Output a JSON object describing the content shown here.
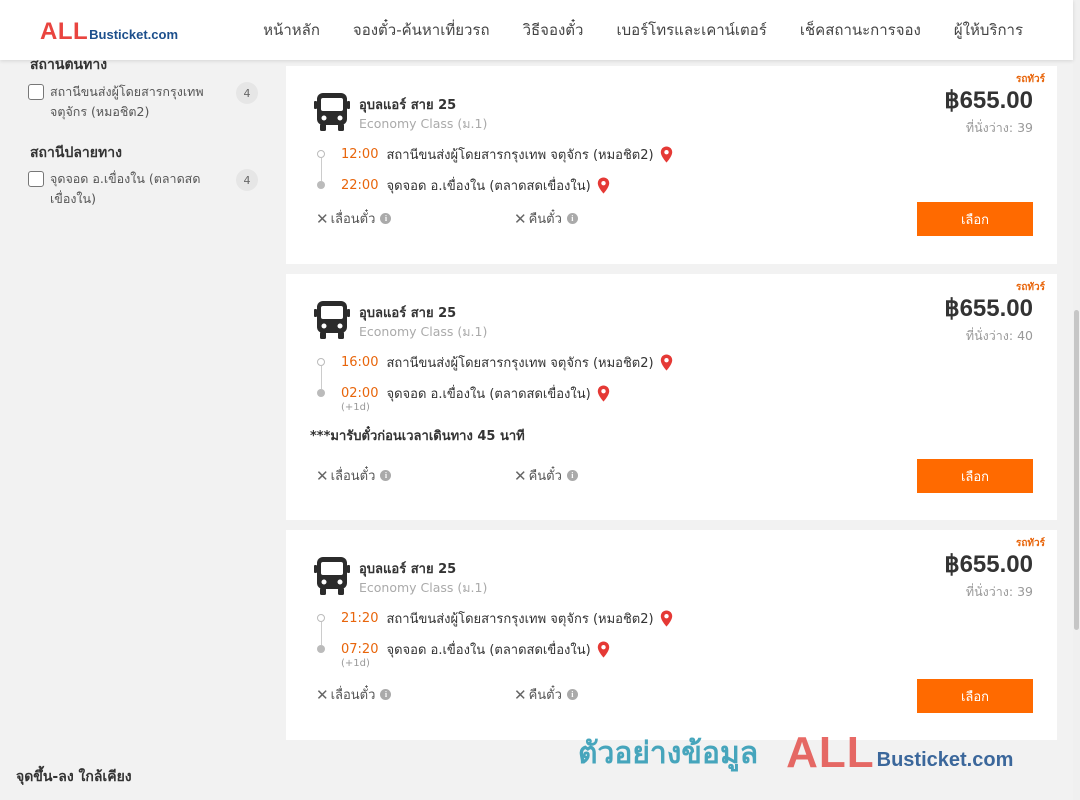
{
  "header": {
    "logo": {
      "all": "ALL",
      "rest": "Busticket.com"
    },
    "nav": [
      {
        "label": "หน้าหลัก"
      },
      {
        "label": "จองตั๋ว-ค้นหาเที่ยวรถ"
      },
      {
        "label": "วิธีจองตั๋ว"
      },
      {
        "label": "เบอร์โทรและเคาน์เตอร์"
      },
      {
        "label": "เช็คสถานะการจอง"
      },
      {
        "label": "ผู้ให้บริการ"
      }
    ]
  },
  "sidebar": {
    "origin": {
      "title": "สถานีต้นทาง",
      "options": [
        {
          "label": "สถานีขนส่งผู้โดยสารกรุงเทพ จตุจักร (หมอชิต2)",
          "count": "4"
        }
      ]
    },
    "destination": {
      "title": "สถานีปลายทาง",
      "options": [
        {
          "label": "จุดจอด อ.เขื่องใน (ตลาดสดเขื่องใน)",
          "count": "4"
        }
      ]
    },
    "nearby_title": "จุดขึ้น-ลง ใกล้เคียง"
  },
  "colors": {
    "accent": "#ff6a00",
    "time": "#e8650b",
    "pin": "#e53935"
  },
  "trips": [
    {
      "tag": "รถทัวร์",
      "operator": "อุบลแอร์ สาย 25",
      "class": "Economy Class (ม.1)",
      "price": "฿655.00",
      "seats": "ที่นั่งว่าง: 39",
      "depart_time": "12:00",
      "depart_station": "สถานีขนส่งผู้โดยสารกรุงเทพ จตุจักร (หมอชิต2)",
      "arrive_time": "22:00",
      "arrive_station": "จุดจอด อ.เขื่องใน (ตลาดสดเขื่องใน)",
      "next_day": "",
      "note": "",
      "reschedule": "เลื่อนตั๋ว",
      "refund": "คืนตั๋ว",
      "select": "เลือก"
    },
    {
      "tag": "รถทัวร์",
      "operator": "อุบลแอร์ สาย 25",
      "class": "Economy Class (ม.1)",
      "price": "฿655.00",
      "seats": "ที่นั่งว่าง: 40",
      "depart_time": "16:00",
      "depart_station": "สถานีขนส่งผู้โดยสารกรุงเทพ จตุจักร (หมอชิต2)",
      "arrive_time": "02:00",
      "arrive_station": "จุดจอด อ.เขื่องใน (ตลาดสดเขื่องใน)",
      "next_day": "(+1d)",
      "note": "***มารับตั๋วก่อนเวลาเดินทาง 45 นาที",
      "reschedule": "เลื่อนตั๋ว",
      "refund": "คืนตั๋ว",
      "select": "เลือก"
    },
    {
      "tag": "รถทัวร์",
      "operator": "อุบลแอร์ สาย 25",
      "class": "Economy Class (ม.1)",
      "price": "฿655.00",
      "seats": "ที่นั่งว่าง: 39",
      "depart_time": "21:20",
      "depart_station": "สถานีขนส่งผู้โดยสารกรุงเทพ จตุจักร (หมอชิต2)",
      "arrive_time": "07:20",
      "arrive_station": "จุดจอด อ.เขื่องใน (ตลาดสดเขื่องใน)",
      "next_day": "(+1d)",
      "note": "",
      "reschedule": "เลื่อนตั๋ว",
      "refund": "คืนตั๋ว",
      "select": "เลือก"
    }
  ],
  "watermark": {
    "text": "ตัวอย่างข้อมูล",
    "all": "ALL",
    "rest": "Busticket.com"
  }
}
